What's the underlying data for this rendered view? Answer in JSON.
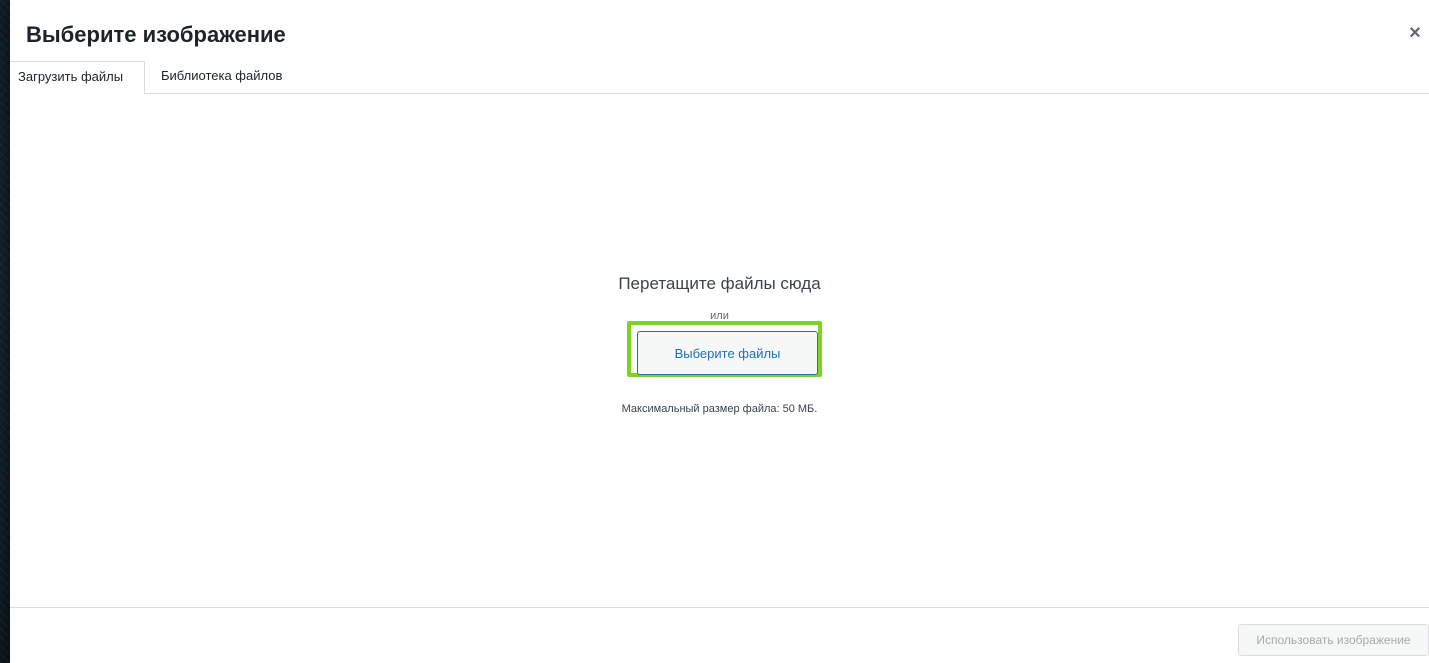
{
  "modal": {
    "title": "Выберите изображение",
    "close_label": "×"
  },
  "tabs": [
    {
      "label": "Загрузить файлы",
      "active": true
    },
    {
      "label": "Библиотека файлов",
      "active": false
    }
  ],
  "uploader": {
    "drop_title": "Перетащите файлы сюда",
    "or_text": "или",
    "select_button": "Выберите файлы",
    "max_size": "Максимальный размер файла: 50 МБ."
  },
  "toolbar": {
    "use_image_button": "Использовать изображение",
    "use_image_enabled": false
  },
  "colors": {
    "highlight": "#7ed321",
    "accent": "#2271b1"
  }
}
